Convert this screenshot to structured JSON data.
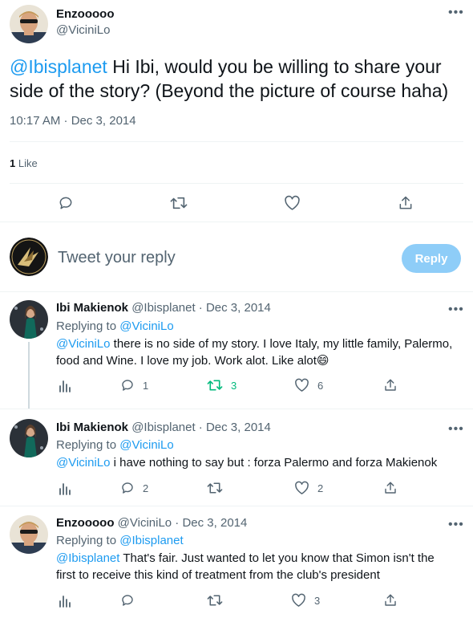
{
  "main_tweet": {
    "display_name": "Enzooooo",
    "handle": "@ViciniLo",
    "mention": "@Ibisplanet",
    "text_line1": " Hi Ibi, would you be willing to share your",
    "text_line2": "side of the story? (Beyond the picture of course haha)",
    "timestamp": "10:17 AM · Dec 3, 2014",
    "likes_count": "1",
    "likes_label": " Like"
  },
  "compose": {
    "placeholder": "Tweet your reply",
    "reply_button": "Reply"
  },
  "replies": [
    {
      "display_name": "Ibi Makienok",
      "handle_date": " @Ibisplanet · Dec 3, 2014",
      "replying_prefix": "Replying to ",
      "replying_to": "@ViciniLo",
      "mention": "@ViciniLo",
      "text_line1": " there is no side of my story. I love Italy, my little family, Palermo,",
      "text_line2": "food and Wine. I love my job. Work alot. Like alot",
      "emoji": "😄",
      "replies_count": "1",
      "retweets_count": "3",
      "likes_count": "6"
    },
    {
      "display_name": "Ibi Makienok",
      "handle_date": " @Ibisplanet · Dec 3, 2014",
      "replying_prefix": "Replying to ",
      "replying_to": "@ViciniLo",
      "mention": "@ViciniLo",
      "text_line1": " i have nothing to say but : forza Palermo and forza Makienok",
      "replies_count": "2",
      "retweets_count": "",
      "likes_count": "2"
    },
    {
      "display_name": "Enzooooo",
      "handle_date": " @ViciniLo · Dec 3, 2014",
      "replying_prefix": "Replying to ",
      "replying_to": "@Ibisplanet",
      "mention": "@Ibisplanet",
      "text_line1": " That's fair. Just wanted to let you know that Simon isn't the",
      "text_line2": "first to receive this kind of treatment from the club's president",
      "replies_count": "",
      "retweets_count": "",
      "likes_count": "3"
    }
  ],
  "colors": {
    "accent": "#1d9bf0",
    "retweet_active": "#00ba7c",
    "secondary_text": "#536471",
    "divider": "#eff3f4",
    "reply_button_disabled": "#8ecdf8"
  },
  "icons": [
    "more-icon",
    "reply-icon",
    "retweet-icon",
    "like-icon",
    "share-icon",
    "analytics-icon"
  ]
}
